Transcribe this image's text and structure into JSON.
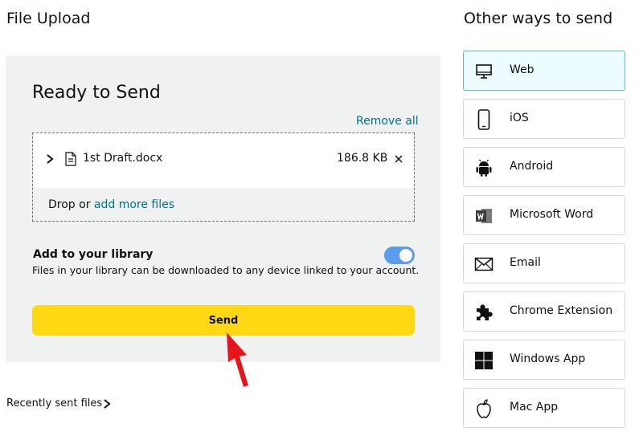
{
  "page": {
    "heading": "File Upload"
  },
  "upload": {
    "title": "Ready to Send",
    "remove_all": "Remove all",
    "file": {
      "name": "1st Draft.docx",
      "size": "186.8 KB"
    },
    "drop_prefix": "Drop or ",
    "add_more": "add more files",
    "library": {
      "title": "Add to your library",
      "description": "Files in your library can be downloaded to any device linked to your account.",
      "enabled": true
    },
    "send_label": "Send"
  },
  "recent": {
    "label": "Recently sent files"
  },
  "other_ways": {
    "heading": "Other ways to send",
    "options": [
      {
        "label": "Web",
        "icon": "monitor-icon",
        "selected": true
      },
      {
        "label": "iOS",
        "icon": "phone-icon",
        "selected": false
      },
      {
        "label": "Android",
        "icon": "android-icon",
        "selected": false
      },
      {
        "label": "Microsoft Word",
        "icon": "word-icon",
        "selected": false
      },
      {
        "label": "Email",
        "icon": "envelope-icon",
        "selected": false
      },
      {
        "label": "Chrome Extension",
        "icon": "puzzle-icon",
        "selected": false
      },
      {
        "label": "Windows App",
        "icon": "windows-icon",
        "selected": false
      },
      {
        "label": "Mac App",
        "icon": "apple-icon",
        "selected": false
      }
    ]
  },
  "colors": {
    "accent_link": "#007185",
    "send_button": "#ffd814",
    "toggle_on": "#5b9cf0",
    "panel_bg": "#f0f2f2",
    "selected_option_bg": "#edfdff",
    "annotation_arrow": "#e8141b"
  }
}
